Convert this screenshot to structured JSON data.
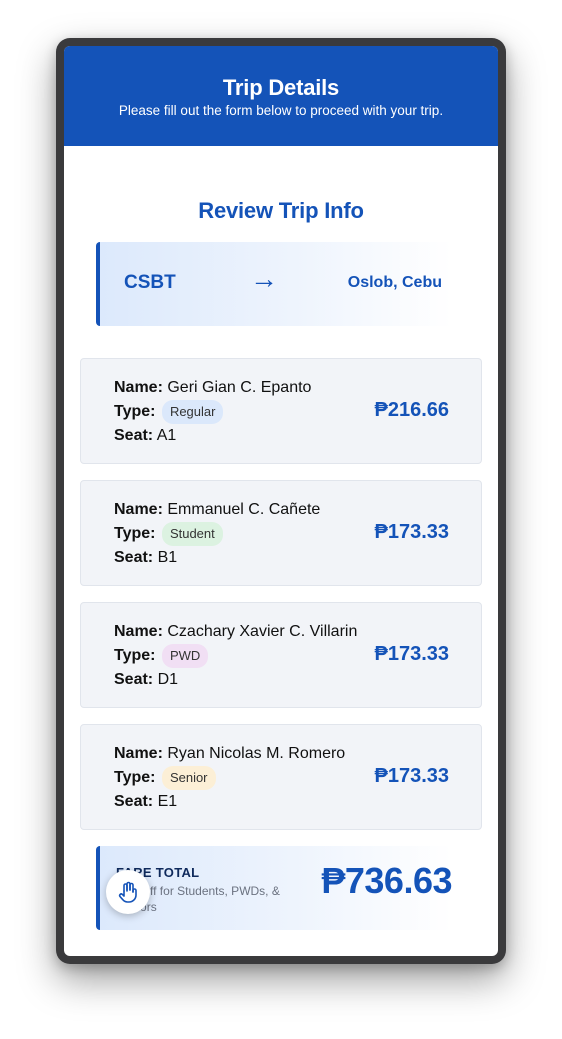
{
  "header": {
    "title": "Trip Details",
    "subtitle": "Please fill out the form below to proceed with your trip."
  },
  "review": {
    "title": "Review Trip Info"
  },
  "route": {
    "origin": "CSBT",
    "arrow": "→",
    "destination": "Oslob, Cebu"
  },
  "labels": {
    "name": "Name:",
    "type": "Type:",
    "seat": "Seat:"
  },
  "passengers": [
    {
      "name": "Geri Gian C. Epanto",
      "type": "Regular",
      "seat": "A1",
      "price": "₱216.66",
      "badge_color": "#dbe8fb"
    },
    {
      "name": "Emmanuel C. Cañete",
      "type": "Student",
      "seat": "B1",
      "price": "₱173.33",
      "badge_color": "#dcf2e1"
    },
    {
      "name": "Czachary Xavier C. Villarin",
      "type": "PWD",
      "seat": "D1",
      "price": "₱173.33",
      "badge_color": "#f1dff4"
    },
    {
      "name": "Ryan Nicolas M. Romero",
      "type": "Senior",
      "seat": "E1",
      "price": "₱173.33",
      "badge_color": "#fcefd6"
    }
  ],
  "total": {
    "label": "FARE TOTAL",
    "note": "20% off for Students, PWDs, & Seniors",
    "amount": "₱736.63"
  },
  "colors": {
    "primary": "#1453b8",
    "card_background": "#f2f4f8"
  },
  "icons": {
    "floating_button": "hand-icon"
  }
}
